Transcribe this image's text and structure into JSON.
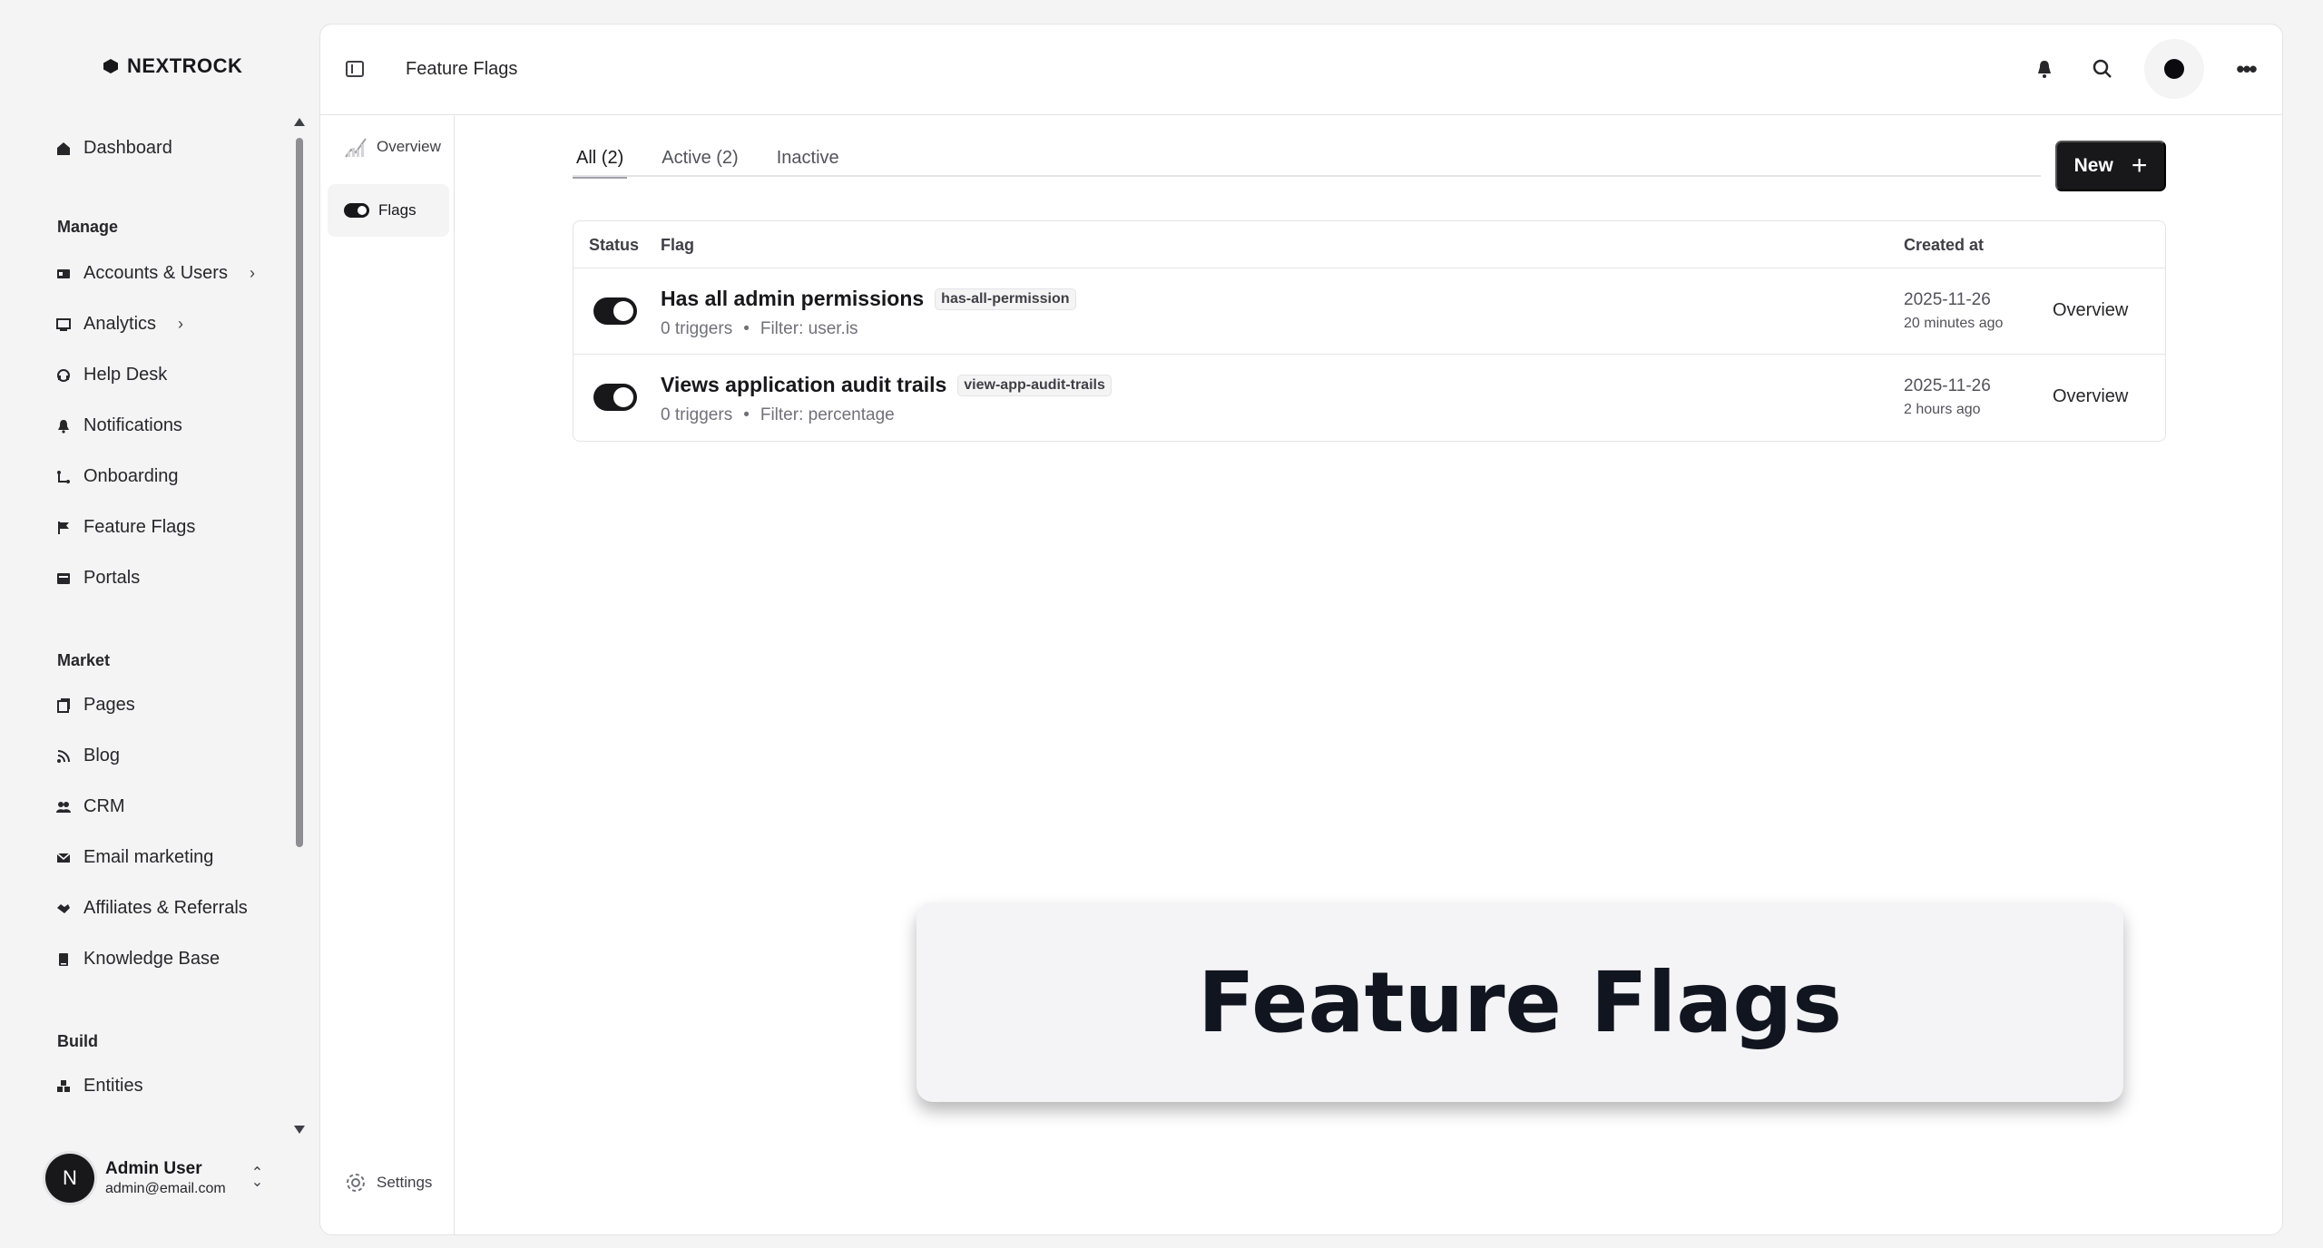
{
  "brand": {
    "name": "NEXTROCK"
  },
  "sidebar": {
    "top_item": {
      "label": "Dashboard",
      "icon": "home-icon"
    },
    "sections": [
      {
        "label": "Manage",
        "items": [
          {
            "label": "Accounts & Users",
            "icon": "id-card-icon",
            "has_chevron": true
          },
          {
            "label": "Analytics",
            "icon": "chart-icon",
            "has_chevron": true
          },
          {
            "label": "Help Desk",
            "icon": "headset-icon"
          },
          {
            "label": "Notifications",
            "icon": "bell-icon"
          },
          {
            "label": "Onboarding",
            "icon": "route-icon"
          },
          {
            "label": "Feature Flags",
            "icon": "flag-icon"
          },
          {
            "label": "Portals",
            "icon": "portal-icon"
          }
        ]
      },
      {
        "label": "Market",
        "items": [
          {
            "label": "Pages",
            "icon": "pages-icon"
          },
          {
            "label": "Blog",
            "icon": "rss-icon"
          },
          {
            "label": "CRM",
            "icon": "users-icon"
          },
          {
            "label": "Email marketing",
            "icon": "mail-icon"
          },
          {
            "label": "Affiliates & Referrals",
            "icon": "handshake-icon"
          },
          {
            "label": "Knowledge Base",
            "icon": "book-icon"
          }
        ]
      },
      {
        "label": "Build",
        "items": [
          {
            "label": "Entities",
            "icon": "cubes-icon"
          }
        ]
      }
    ],
    "user": {
      "initial": "N",
      "name": "Admin User",
      "email": "admin@email.com"
    }
  },
  "topbar": {
    "breadcrumb": "Feature Flags"
  },
  "subnav": {
    "items": [
      {
        "label": "Overview",
        "icon": "chart-icon"
      },
      {
        "label": "Flags",
        "icon": "toggle-icon",
        "active": true
      }
    ],
    "settings": "Settings"
  },
  "tabs": [
    {
      "label": "All (2)",
      "active": true
    },
    {
      "label": "Active (2)"
    },
    {
      "label": "Inactive"
    }
  ],
  "new_button": {
    "label": "New",
    "icon": "plus-icon"
  },
  "table": {
    "headers": {
      "status": "Status",
      "flag": "Flag",
      "created": "Created at"
    },
    "rows": [
      {
        "name": "Has all admin permissions",
        "key": "has-all-permission",
        "triggers": "0 triggers",
        "filter": "Filter: user.is",
        "date": "2025-11-26",
        "relative": "20 minutes ago",
        "action": "Overview",
        "enabled": true
      },
      {
        "name": "Views application audit trails",
        "key": "view-app-audit-trails",
        "triggers": "0 triggers",
        "filter": "Filter: percentage",
        "date": "2025-11-26",
        "relative": "2 hours ago",
        "action": "Overview",
        "enabled": true
      }
    ]
  },
  "overlay": {
    "title": "Feature Flags"
  },
  "colors": {
    "accent": "#18181b",
    "surface": "#ffffff",
    "background": "#f4f4f5",
    "border": "#e4e4e7"
  }
}
